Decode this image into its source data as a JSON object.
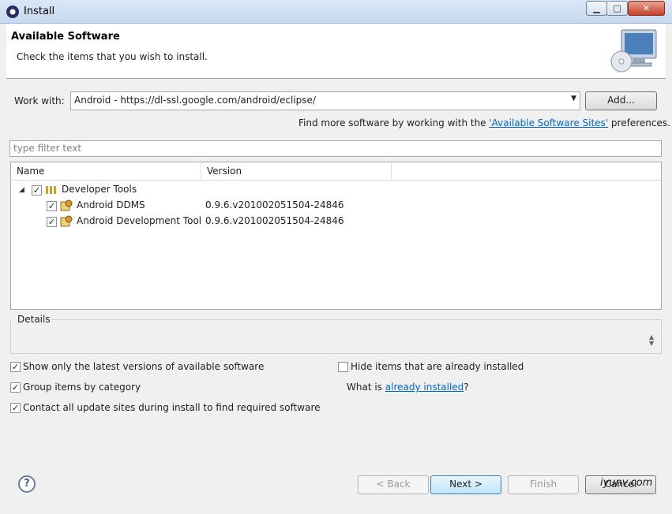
{
  "window": {
    "title": "Install"
  },
  "banner": {
    "title": "Available Software",
    "subtitle": "Check the items that you wish to install."
  },
  "work_with": {
    "label": "Work with:",
    "value": "Android - https://dl-ssl.google.com/android/eclipse/",
    "add_label": "Add..."
  },
  "find_more": {
    "prefix": "Find more software by working with the ",
    "link": "'Available Software Sites'",
    "suffix": " preferences."
  },
  "filter": {
    "placeholder": "type filter text"
  },
  "table": {
    "columns": [
      "Name",
      "Version"
    ],
    "group": {
      "name": "Developer Tools"
    },
    "items": [
      {
        "name": "Android DDMS",
        "version": "0.9.6.v201002051504-24846"
      },
      {
        "name": "Android Development Tool",
        "version": "0.9.6.v201002051504-24846"
      }
    ]
  },
  "details": {
    "label": "Details"
  },
  "options": {
    "latest": "Show only the latest versions of available software",
    "group": "Group items by category",
    "contact": "Contact all update sites during install to find required software",
    "hide": "Hide items that are already installed",
    "what_is": "What is ",
    "already_installed": "already installed",
    "question": "?"
  },
  "buttons": {
    "back": "< Back",
    "next": "Next >",
    "finish": "Finish",
    "cancel": "Cancel"
  },
  "help": "?",
  "watermark": "iyunv.com"
}
